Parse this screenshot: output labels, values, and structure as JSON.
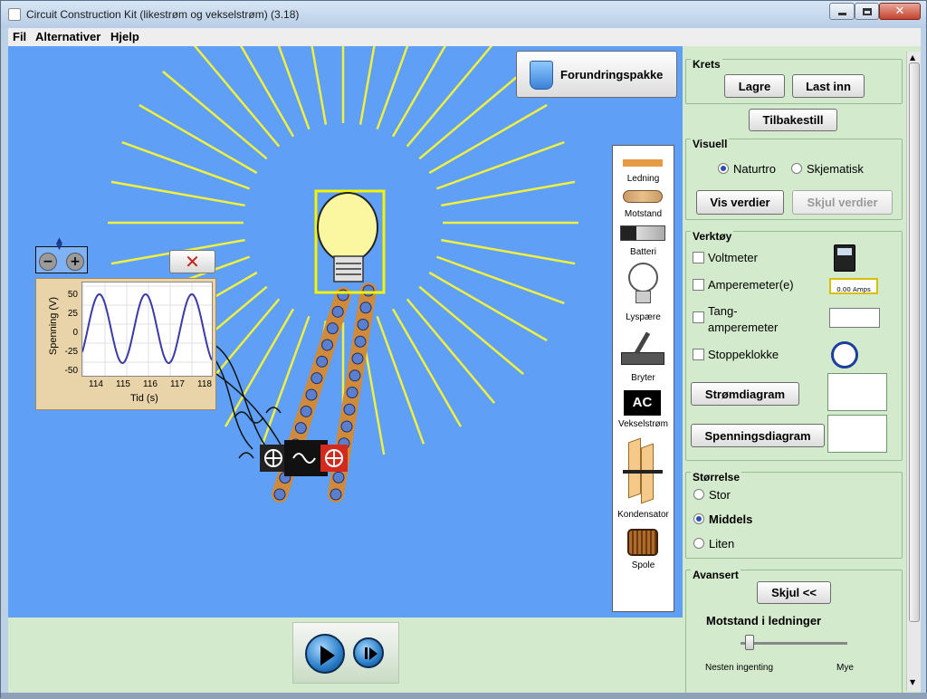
{
  "window": {
    "title": "Circuit Construction Kit (likestrøm og vekselstrøm) (3.18)"
  },
  "menu": [
    "Fil",
    "Alternativer",
    "Hjelp"
  ],
  "canvas": {
    "grab_bag_label": "Forundringspakke",
    "chart": {
      "ylabel": "Spenning (V)",
      "xlabel": "Tid (s)",
      "yticks": [
        "50",
        "25",
        "0",
        "-25",
        "-50"
      ],
      "xticks": [
        "114",
        "115",
        "116",
        "117",
        "118"
      ]
    }
  },
  "toolbox": {
    "items": [
      "Ledning",
      "Motstand",
      "Batteri",
      "Lyspære",
      "Bryter",
      "Vekselstrøm",
      "Kondensator",
      "Spole"
    ],
    "ac_badge": "AC"
  },
  "side": {
    "krets": {
      "title": "Krets",
      "save": "Lagre",
      "load": "Last inn",
      "reset": "Tilbakestill"
    },
    "visuell": {
      "title": "Visuell",
      "opt1": "Naturtro",
      "opt2": "Skjematisk",
      "show_values": "Vis verdier",
      "hide_values": "Skjul verdier",
      "selected": "Naturtro"
    },
    "verktoy": {
      "title": "Verktøy",
      "voltmeter": "Voltmeter",
      "ammeter": "Amperemeter(e)",
      "tang": "Tang-",
      "tang2": "amperemeter",
      "stopwatch": "Stoppeklokke",
      "current_chart": "Strømdiagram",
      "voltage_chart": "Spenningsdiagram",
      "amps_readout": "0.00 Amps"
    },
    "storrelse": {
      "title": "Størrelse",
      "big": "Stor",
      "medium": "Middels",
      "small": "Liten",
      "selected": "Middels"
    },
    "avansert": {
      "title": "Avansert",
      "hide": "Skjul <<",
      "wire_resistance": "Motstand i ledninger",
      "min_label": "Nesten ingenting",
      "max_label": "Mye",
      "wire_resistance_level": 0.05
    }
  },
  "colors": {
    "canvas": "#5f9ff5",
    "panel": "#d4eacc",
    "rays": "#f0f040",
    "wire": "#d08a3c"
  }
}
